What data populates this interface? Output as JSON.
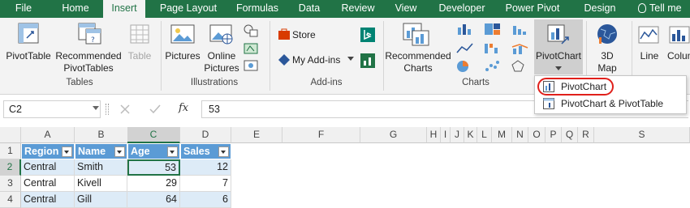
{
  "tabs": [
    "File",
    "Home",
    "Insert",
    "Page Layout",
    "Formulas",
    "Data",
    "Review",
    "View",
    "Developer",
    "Power Pivot",
    "Design",
    "Tell me"
  ],
  "ribbon": {
    "tables": {
      "pivottable": "PivotTable",
      "recommended_l1": "Recommended",
      "recommended_l2": "PivotTables",
      "table": "Table",
      "group": "Tables"
    },
    "illustrations": {
      "pictures": "Pictures",
      "online_l1": "Online",
      "online_l2": "Pictures",
      "group": "Illustrations"
    },
    "addins": {
      "store": "Store",
      "my_addins": "My Add-ins",
      "group": "Add-ins"
    },
    "charts": {
      "rec_l1": "Recommended",
      "rec_l2": "Charts",
      "pivotchart": "PivotChart",
      "group": "Charts"
    },
    "map3d": {
      "l1": "3D",
      "l2": "Map"
    },
    "sparklines": {
      "line": "Line",
      "column": "Colum"
    }
  },
  "pivot_menu": {
    "item1": "PivotChart",
    "item2": "PivotChart & PivotTable"
  },
  "formula_bar": {
    "name_box": "C2",
    "fx": "fx",
    "value": "53"
  },
  "columns": [
    "A",
    "B",
    "C",
    "D",
    "E",
    "F",
    "G",
    "H",
    "I",
    "J",
    "K",
    "L",
    "M",
    "N",
    "O",
    "P",
    "Q",
    "R",
    "S"
  ],
  "rows": [
    "1",
    "2",
    "3",
    "4"
  ],
  "table": {
    "headers": [
      "Region",
      "Name",
      "Age",
      "Sales"
    ],
    "data": [
      [
        "Central",
        "Smith",
        "53",
        "12"
      ],
      [
        "Central",
        "Kivell",
        "29",
        "7"
      ],
      [
        "Central",
        "Gill",
        "64",
        "6"
      ]
    ]
  },
  "colors": {
    "excel_green": "#217346",
    "table_header": "#5b9bd5",
    "band": "#ddebf7",
    "highlight_ring": "#e0201b"
  }
}
